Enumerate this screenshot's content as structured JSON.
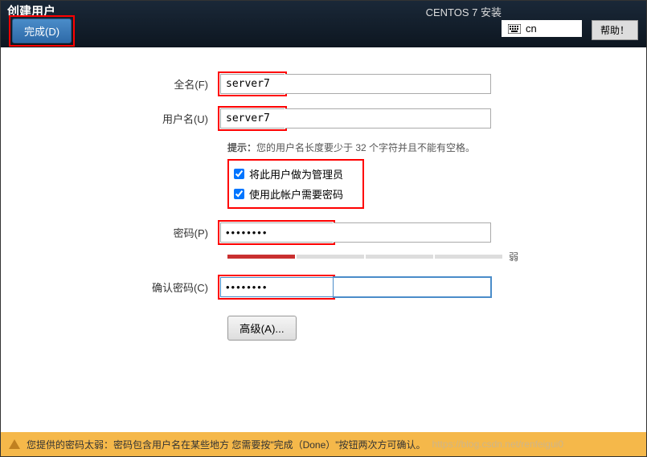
{
  "header": {
    "title": "创建用户",
    "done_label": "完成(D)",
    "installer_title": "CENTOS 7 安装",
    "keyboard_layout": "cn",
    "help_label": "帮助！"
  },
  "form": {
    "fullname_label": "全名(F)",
    "fullname_value": "server7",
    "username_label": "用户名(U)",
    "username_value": "server7",
    "hint_prefix": "提示：",
    "hint_text": "您的用户名长度要少于 32 个字符并且不能有空格。",
    "admin_check_label": "将此用户做为管理员",
    "admin_checked": true,
    "reqpw_check_label": "使用此帐户需要密码",
    "reqpw_checked": true,
    "password_label": "密码(P)",
    "password_value": "••••••••",
    "strength_label": "弱",
    "confirm_label": "确认密码(C)",
    "confirm_value": "••••••••",
    "advanced_label": "高级(A)..."
  },
  "warning": {
    "text": "您提供的密码太弱：密码包含用户名在某些地方  您需要按\"完成（Done）\"按钮两次方可确认。",
    "watermark": "https://blog.csdn.net/renfeigui0"
  }
}
